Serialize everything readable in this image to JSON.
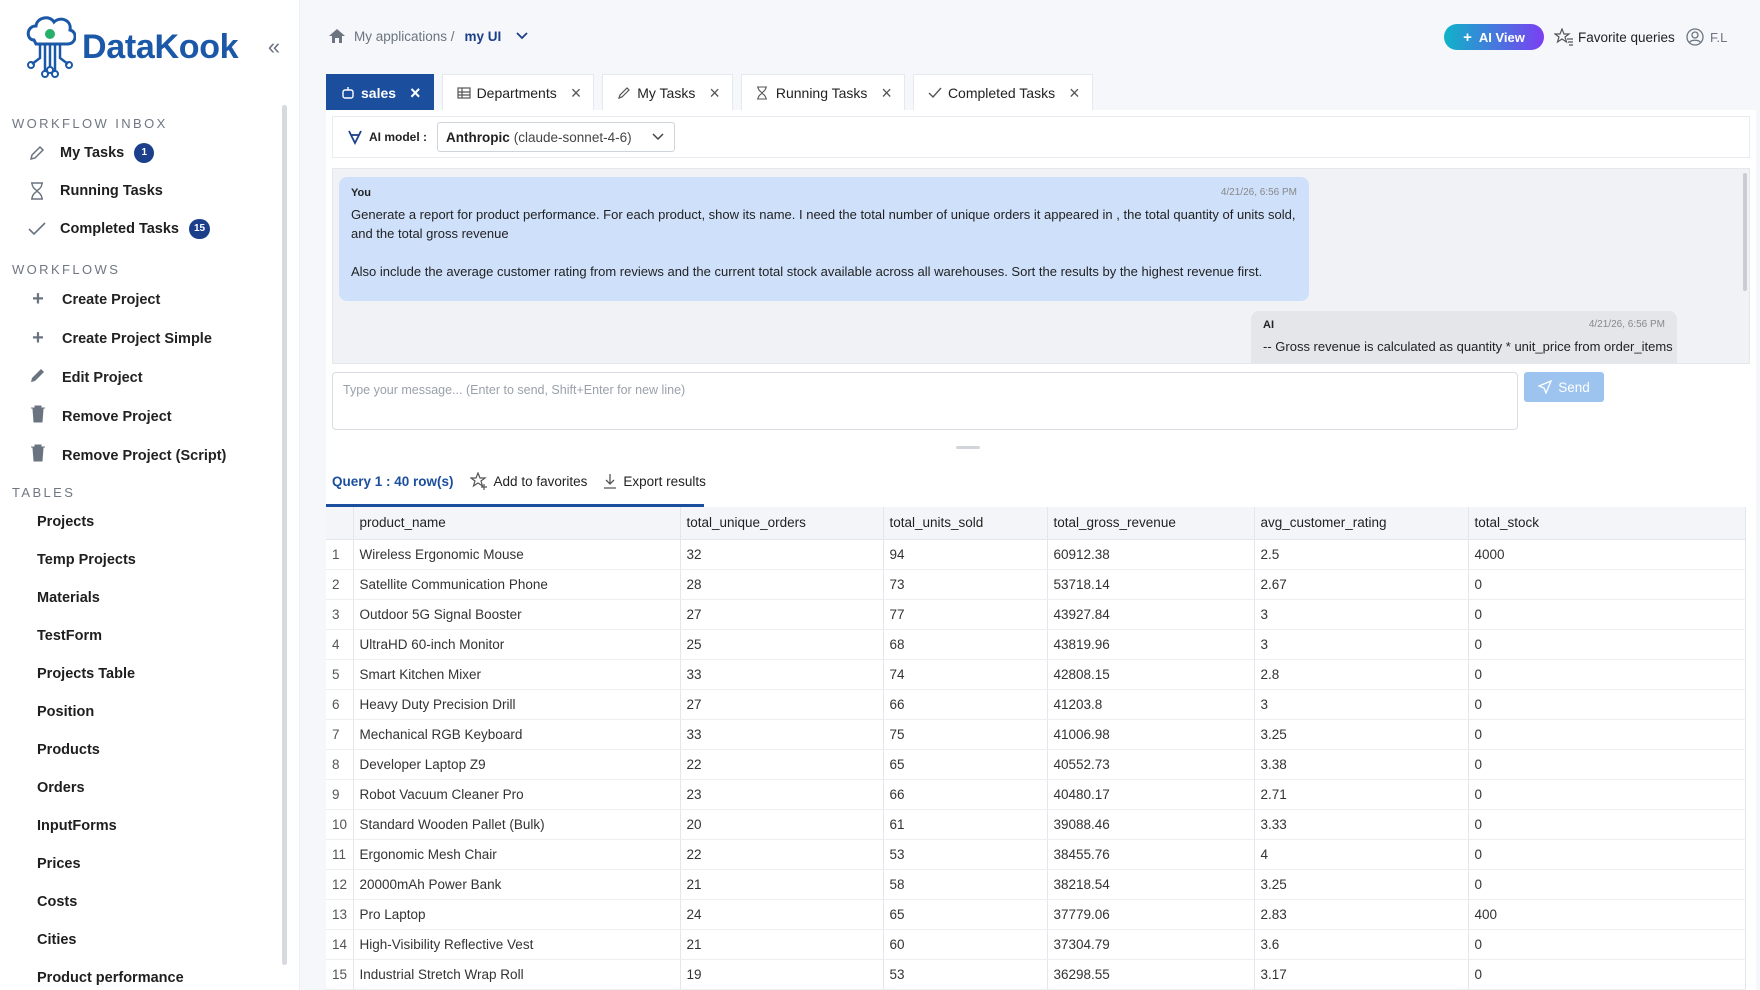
{
  "brand": {
    "name": "DataKook"
  },
  "sidebar": {
    "workflow_inbox_title": "WORKFLOW INBOX",
    "inbox": [
      {
        "label": "My Tasks",
        "badge": "1",
        "icon": "pencil-icon"
      },
      {
        "label": "Running Tasks",
        "badge": "",
        "icon": "hourglass-icon"
      },
      {
        "label": "Completed Tasks",
        "badge": "15",
        "icon": "check-icon"
      }
    ],
    "workflows_title": "WORKFLOWS",
    "workflows": [
      {
        "label": "Create Project",
        "icon": "plus-icon"
      },
      {
        "label": "Create Project Simple",
        "icon": "plus-icon"
      },
      {
        "label": "Edit Project",
        "icon": "pencil-filled-icon"
      },
      {
        "label": "Remove Project",
        "icon": "trash-icon"
      },
      {
        "label": "Remove Project (Script)",
        "icon": "trash-filled-icon"
      }
    ],
    "tables_title": "TABLES",
    "tables": [
      "Projects",
      "Temp Projects",
      "Materials",
      "TestForm",
      "Projects Table",
      "Position",
      "Products",
      "Orders",
      "InputForms",
      "Prices",
      "Costs",
      "Cities",
      "Product performance"
    ]
  },
  "header": {
    "breadcrumb_root": "My applications /",
    "breadcrumb_current": "my UI",
    "ai_view": "AI View",
    "favorite_queries": "Favorite queries",
    "user": "F.L"
  },
  "tabs": [
    {
      "label": "sales",
      "active": true
    },
    {
      "label": "Departments",
      "active": false
    },
    {
      "label": "My Tasks",
      "active": false
    },
    {
      "label": "Running Tasks",
      "active": false
    },
    {
      "label": "Completed Tasks",
      "active": false
    }
  ],
  "ai_model": {
    "label": "AI model :",
    "provider": "Anthropic",
    "model": "(claude-sonnet-4-6)"
  },
  "chat": {
    "you": {
      "author": "You",
      "timestamp": "4/21/26, 6:56 PM",
      "para1": "Generate a report for product performance. For each product, show its name. I need the total number  of unique orders it appeared in , the total quantity of units sold, and the total gross revenue",
      "para2": "Also include the average customer rating from reviews and the current total stock available across all warehouses. Sort the results by the highest revenue first."
    },
    "ai": {
      "author": "AI",
      "timestamp": "4/21/26, 6:56 PM",
      "text": "-- Gross revenue is calculated as quantity * unit_price from order_items"
    },
    "input_placeholder": "Type your message... (Enter to send, Shift+Enter for new line)",
    "send": "Send"
  },
  "results": {
    "query_label": "Query 1 : 40 row(s)",
    "add_favorites": "Add to favorites",
    "export": "Export results",
    "columns": [
      "product_name",
      "total_unique_orders",
      "total_units_sold",
      "total_gross_revenue",
      "avg_customer_rating",
      "total_stock"
    ],
    "rows": [
      [
        "1",
        "Wireless Ergonomic Mouse",
        "32",
        "94",
        "60912.38",
        "2.5",
        "4000"
      ],
      [
        "2",
        "Satellite Communication Phone",
        "28",
        "73",
        "53718.14",
        "2.67",
        "0"
      ],
      [
        "3",
        "Outdoor 5G Signal Booster",
        "27",
        "77",
        "43927.84",
        "3",
        "0"
      ],
      [
        "4",
        "UltraHD 60-inch Monitor",
        "25",
        "68",
        "43819.96",
        "3",
        "0"
      ],
      [
        "5",
        "Smart Kitchen Mixer",
        "33",
        "74",
        "42808.15",
        "2.8",
        "0"
      ],
      [
        "6",
        "Heavy Duty Precision Drill",
        "27",
        "66",
        "41203.8",
        "3",
        "0"
      ],
      [
        "7",
        "Mechanical RGB Keyboard",
        "33",
        "75",
        "41006.98",
        "3.25",
        "0"
      ],
      [
        "8",
        "Developer Laptop Z9",
        "22",
        "65",
        "40552.73",
        "3.38",
        "0"
      ],
      [
        "9",
        "Robot Vacuum Cleaner Pro",
        "23",
        "66",
        "40480.17",
        "2.71",
        "0"
      ],
      [
        "10",
        "Standard Wooden Pallet (Bulk)",
        "20",
        "61",
        "39088.46",
        "3.33",
        "0"
      ],
      [
        "11",
        "Ergonomic Mesh Chair",
        "22",
        "53",
        "38455.76",
        "4",
        "0"
      ],
      [
        "12",
        "20000mAh Power Bank",
        "21",
        "58",
        "38218.54",
        "3.25",
        "0"
      ],
      [
        "13",
        "Pro Laptop",
        "24",
        "65",
        "37779.06",
        "2.83",
        "400"
      ],
      [
        "14",
        "High-Visibility Reflective Vest",
        "21",
        "60",
        "37304.79",
        "3.6",
        "0"
      ],
      [
        "15",
        "Industrial Stretch Wrap Roll",
        "19",
        "53",
        "36298.55",
        "3.17",
        "0"
      ]
    ]
  },
  "colors": {
    "brand": "#1b58a8",
    "active_tab": "#1b4f9e",
    "badge": "#1b3f8a",
    "user_bubble": "#cfe0fb"
  }
}
